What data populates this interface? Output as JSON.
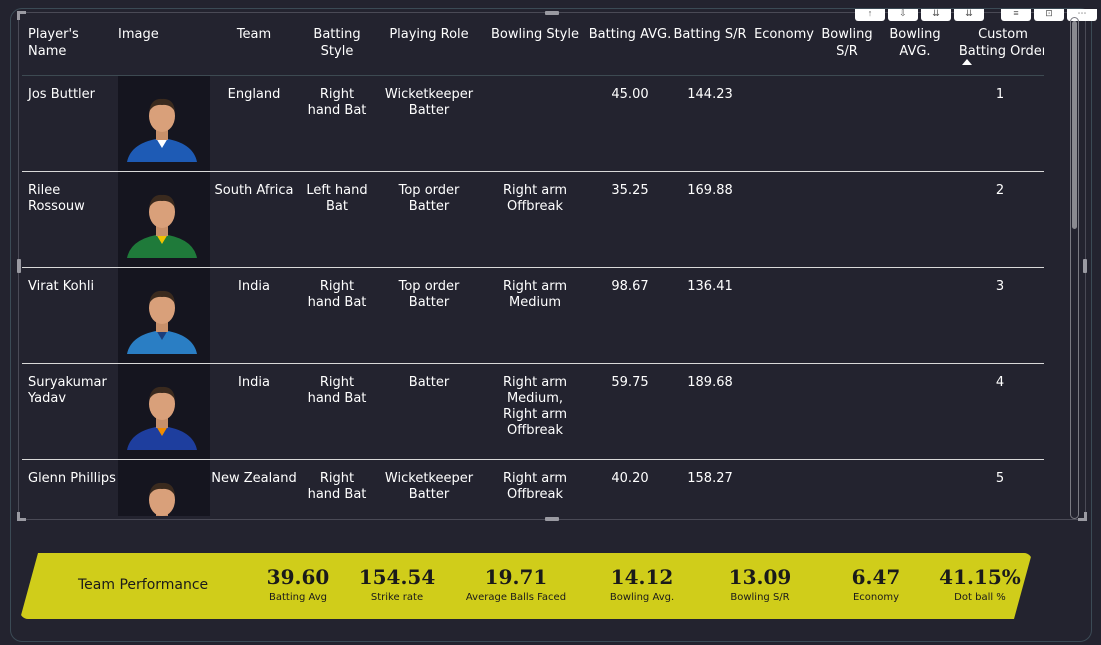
{
  "columns": [
    {
      "key": "name",
      "label": "Player's Name"
    },
    {
      "key": "image",
      "label": "Image"
    },
    {
      "key": "team",
      "label": "Team"
    },
    {
      "key": "batting_style",
      "label": "Batting Style"
    },
    {
      "key": "playing_role",
      "label": "Playing Role"
    },
    {
      "key": "bowling_style",
      "label": "Bowling Style"
    },
    {
      "key": "batting_avg",
      "label": "Batting AVG."
    },
    {
      "key": "batting_sr",
      "label": "Batting S/R"
    },
    {
      "key": "economy",
      "label": "Economy"
    },
    {
      "key": "bowling_sr",
      "label": "Bowling S/R"
    },
    {
      "key": "bowling_avg",
      "label": "Bowling AVG."
    },
    {
      "key": "custom_order",
      "label": "Custom Batting Order"
    }
  ],
  "rows": [
    {
      "name": "Jos Buttler",
      "team": "England",
      "batting_style": "Right hand Bat",
      "playing_role": "Wicketkeeper Batter",
      "bowling_style": "",
      "batting_avg": "45.00",
      "batting_sr": "144.23",
      "economy": "",
      "bowling_sr": "",
      "bowling_avg": "",
      "custom_order": "1"
    },
    {
      "name": "Rilee Rossouw",
      "team": "South Africa",
      "batting_style": "Left hand Bat",
      "playing_role": "Top order Batter",
      "bowling_style": "Right arm Offbreak",
      "batting_avg": "35.25",
      "batting_sr": "169.88",
      "economy": "",
      "bowling_sr": "",
      "bowling_avg": "",
      "custom_order": "2"
    },
    {
      "name": "Virat Kohli",
      "team": "India",
      "batting_style": "Right hand Bat",
      "playing_role": "Top order Batter",
      "bowling_style": "Right arm Medium",
      "batting_avg": "98.67",
      "batting_sr": "136.41",
      "economy": "",
      "bowling_sr": "",
      "bowling_avg": "",
      "custom_order": "3"
    },
    {
      "name": "Suryakumar Yadav",
      "team": "India",
      "batting_style": "Right hand Bat",
      "playing_role": "Batter",
      "bowling_style": "Right arm Medium, Right arm Offbreak",
      "batting_avg": "59.75",
      "batting_sr": "189.68",
      "economy": "",
      "bowling_sr": "",
      "bowling_avg": "",
      "custom_order": "4"
    },
    {
      "name": "Glenn Phillips",
      "team": "New Zealand",
      "batting_style": "Right hand Bat",
      "playing_role": "Wicketkeeper Batter",
      "bowling_style": "Right arm Offbreak",
      "batting_avg": "40.20",
      "batting_sr": "158.27",
      "economy": "",
      "bowling_sr": "",
      "bowling_avg": "",
      "custom_order": "5"
    }
  ],
  "performance": {
    "title": "Team Performance",
    "kpis": [
      {
        "value": "39.60",
        "label": "Batting Avg"
      },
      {
        "value": "154.54",
        "label": "Strike rate"
      },
      {
        "value": "19.71",
        "label": "Average Balls Faced"
      },
      {
        "value": "14.12",
        "label": "Bowling Avg."
      },
      {
        "value": "13.09",
        "label": "Bowling S/R"
      },
      {
        "value": "6.47",
        "label": "Economy"
      },
      {
        "value": "41.15%",
        "label": "Dot ball %"
      }
    ]
  },
  "colors": {
    "background": "#23232f",
    "band": "#d0cd1a",
    "image_cell": "#15151f",
    "row_divider": "#d9d9d9"
  },
  "jerseys": [
    "#1e5bb5",
    "#1f7a3a",
    "#2a7ec4",
    "#1e3e9e",
    "#1c2a5a"
  ],
  "accents": [
    "#ffffff",
    "#f2c300",
    "#1b3d7a",
    "#f28c00",
    "#c0392b"
  ]
}
